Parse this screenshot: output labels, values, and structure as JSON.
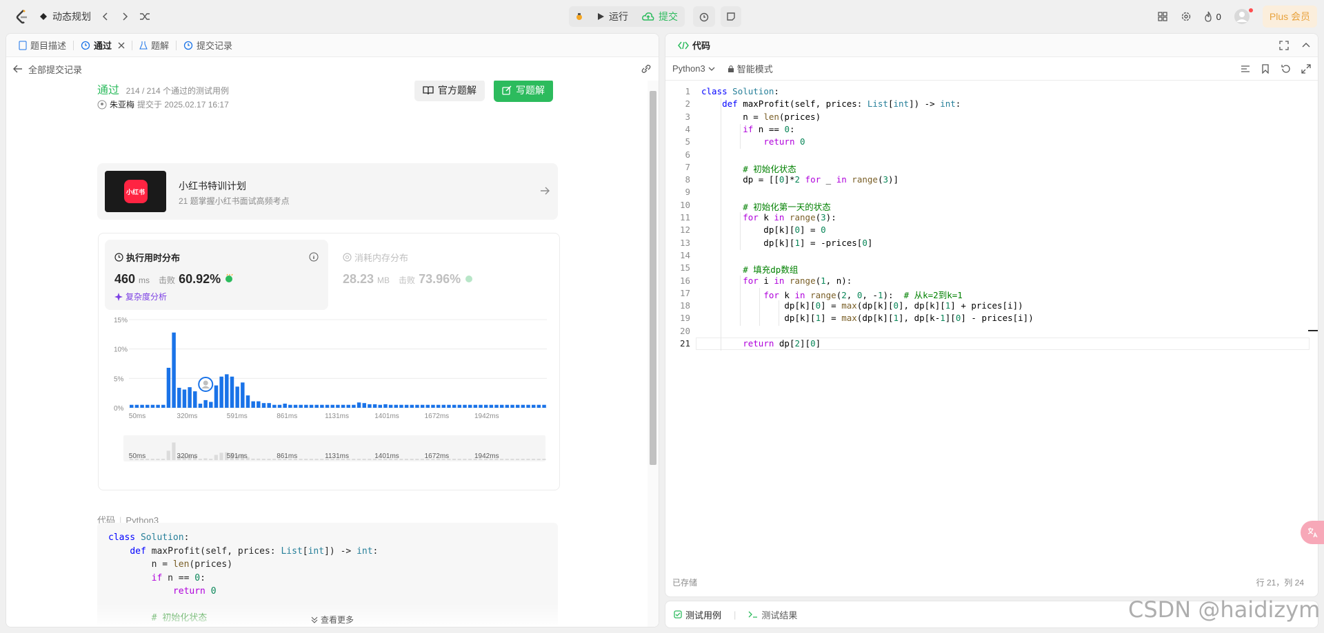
{
  "topbar": {
    "problem": "动态规划",
    "run": "运行",
    "submit": "提交",
    "fire_count": "0",
    "plus": "Plus 会员"
  },
  "left": {
    "tabs": [
      "题目描述",
      "通过",
      "题解",
      "提交记录"
    ],
    "back_label": "全部提交记录",
    "status": "通过",
    "cases": "214 / 214 个通过的测试用例",
    "user": "朱亚梅",
    "submitted": "提交于 2025.02.17 16:17",
    "official_btn": "官方题解",
    "write_btn": "写题解",
    "promo_title": "小红书特训计划",
    "promo_sub": "21 题掌握小红书面试高频考点",
    "promo_logo": "小红书",
    "runtime": {
      "title": "执行用时分布",
      "value": "460",
      "unit": "ms",
      "beat_label": "击败",
      "beat": "60.92%",
      "analysis": "复杂度分析"
    },
    "memory": {
      "title": "消耗内存分布",
      "value": "28.23",
      "unit": "MB",
      "beat_label": "击败",
      "beat": "73.96%"
    },
    "code_label": "代码",
    "code_lang": "Python3",
    "more": "查看更多",
    "code_lines": [
      "class Solution:",
      "    def maxProfit(self, prices: List[int]) -> int:",
      "        n = len(prices)",
      "        if n == 0:",
      "            return 0",
      "",
      "        # 初始化状态",
      "        dp = [[0]*2 for _ in range(3)]"
    ]
  },
  "chart_data": {
    "type": "bar",
    "ylabels": [
      "15%",
      "10%",
      "5%",
      "0%"
    ],
    "xlabels": [
      "50ms",
      "320ms",
      "591ms",
      "861ms",
      "1131ms",
      "1401ms",
      "1672ms",
      "1942ms"
    ],
    "ylim": [
      0,
      15
    ],
    "values": [
      0.5,
      0.5,
      0.5,
      0.5,
      0.5,
      0.5,
      0.5,
      6.8,
      12.8,
      3.4,
      3.1,
      3.5,
      2.8,
      0.7,
      1.3,
      1,
      3.8,
      5.3,
      5.7,
      5.3,
      3.6,
      4.3,
      2.1,
      1.1,
      1.1,
      0.8,
      0.8,
      0.5,
      0.5,
      0.7,
      0.5,
      0.5,
      0.5,
      0.5,
      0.5,
      0.5,
      0.5,
      0.5,
      0.5,
      0.5,
      0.5,
      0.5,
      0.5,
      0.9,
      0.8,
      0.6,
      0.6,
      0.5,
      0.6,
      0.5,
      0.5,
      0.5,
      0.5,
      0.5,
      0.5,
      0.5,
      0.5,
      0.5,
      0.5,
      0.5,
      0.5,
      0.5,
      0.5,
      0.5,
      0.5,
      0.5,
      0.5,
      0.5,
      0.5,
      0.5,
      0.5,
      0.5,
      0.5,
      0.5,
      0.5,
      0.5,
      0.5,
      0.5,
      0.5
    ],
    "highlight_index": 14,
    "color": "#1a73e8"
  },
  "right": {
    "title": "代码",
    "lang": "Python3",
    "mode": "智能模式",
    "saved": "已存储",
    "cursor": "行 21，列 24",
    "bottom_tabs": [
      "测试用例",
      "测试结果"
    ],
    "code": [
      "class Solution:",
      "    def maxProfit(self, prices: List[int]) -> int:",
      "        n = len(prices)",
      "        if n == 0:",
      "            return 0",
      "",
      "        # 初始化状态",
      "        dp = [[0]*2 for _ in range(3)]",
      "",
      "        # 初始化第一天的状态",
      "        for k in range(3):",
      "            dp[k][0] = 0",
      "            dp[k][1] = -prices[0]",
      "",
      "        # 填充dp数组",
      "        for i in range(1, n):",
      "            for k in range(2, 0, -1):  # 从k=2到k=1",
      "                dp[k][0] = max(dp[k][0], dp[k][1] + prices[i])",
      "                dp[k][1] = max(dp[k][1], dp[k-1][0] - prices[i])",
      "",
      "        return dp[2][0]"
    ]
  },
  "watermark": "CSDN @haidizym",
  "colors": {
    "green": "#2cbb5d",
    "blue": "#1a73e8",
    "accent": "#e8a23c"
  }
}
